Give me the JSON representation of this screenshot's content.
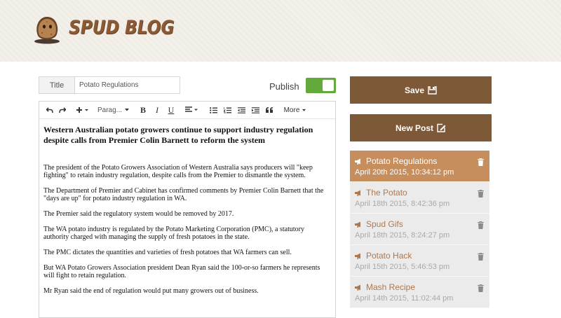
{
  "header": {
    "brand": "SPUD BLOG",
    "logo_icon": "potato-logo-icon"
  },
  "form": {
    "title_label": "Title",
    "title_value": "Potato Regulations",
    "publish_label": "Publish",
    "publish_on": true,
    "publish_color": "#63a93c"
  },
  "toolbar": {
    "undo_icon": "undo-icon",
    "redo_icon": "redo-icon",
    "insert_icon": "plus-icon",
    "format_select": "Parag...",
    "bold": "B",
    "italic": "I",
    "underline": "U",
    "align_icon": "align-left-icon",
    "more": "More"
  },
  "document": {
    "heading": "Western Australian potato growers continue to support industry regulation despite calls from Premier Colin Barnett to reform the system",
    "paragraphs": [
      "The president of the Potato Growers Association of Western Australia says producers will \"keep fighting\" to retain industry regulation, despite calls from the Premier to dismantle the system.",
      "The Department of Premier and Cabinet has confirmed comments by Premier Colin Barnett that the \"days are up\" for potato industry regulation in WA.",
      "The Premier said the regulatory system would be removed by 2017.",
      "The WA potato industry is regulated by the Potato Marketing Corporation (PMC), a statutory authority charged with managing the supply of fresh potatoes in the state.",
      "The PMC dictates the quantities and varieties of fresh potatoes that WA farmers can sell.",
      "But WA Potato Growers Association president Dean Ryan said the 100-or-so farmers he represents will fight to retain regulation.",
      "Mr Ryan said the end of regulation would put many growers out of business."
    ]
  },
  "sidebar": {
    "save_label": "Save",
    "new_post_label": "New Post",
    "button_color": "#7d5938",
    "active_color": "#c68d5d",
    "posts": [
      {
        "title": "Potato Regulations",
        "date": "April 20th 2015, 10:34:12 pm",
        "active": true
      },
      {
        "title": "The Potato",
        "date": "April 18th 2015, 8:42:36 pm",
        "active": false
      },
      {
        "title": "Spud Gifs",
        "date": "April 18th 2015, 8:24:27 pm",
        "active": false
      },
      {
        "title": "Potato Hack",
        "date": "April 15th 2015, 5:46:53 pm",
        "active": false
      },
      {
        "title": "Mash Recipe",
        "date": "April 14th 2015, 11:02:44 pm",
        "active": false
      }
    ]
  }
}
